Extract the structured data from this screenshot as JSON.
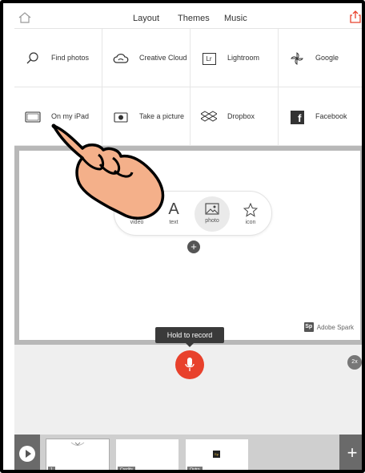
{
  "topbar": {
    "tabs": [
      "Layout",
      "Themes",
      "Music"
    ],
    "home_icon": "home-icon",
    "share_icon": "share-icon",
    "accent": "#e8412c"
  },
  "sources": [
    {
      "label": "Find photos",
      "icon": "search-icon"
    },
    {
      "label": "Creative Cloud",
      "icon": "creative-cloud-icon"
    },
    {
      "label": "Lightroom",
      "icon": "lightroom-icon",
      "icon_text": "Lr"
    },
    {
      "label": "Google",
      "icon": "google-photos-icon"
    },
    {
      "label": "On my iPad",
      "icon": "ipad-icon"
    },
    {
      "label": "Take a picture",
      "icon": "camera-icon"
    },
    {
      "label": "Dropbox",
      "icon": "dropbox-icon"
    },
    {
      "label": "Facebook",
      "icon": "facebook-icon",
      "icon_text": "f"
    }
  ],
  "content_options": [
    {
      "label": "video",
      "icon": "video-icon"
    },
    {
      "label": "text",
      "icon": "text-icon",
      "glyph": "A"
    },
    {
      "label": "photo",
      "icon": "photo-icon",
      "active": true
    },
    {
      "label": "icon",
      "icon": "star-icon"
    }
  ],
  "add_button": "+",
  "brand": {
    "badge": "Sp",
    "name": "Adobe Spark"
  },
  "record": {
    "tooltip": "Hold to record",
    "mic_color": "#e8412c",
    "speed": "2x"
  },
  "filmstrip": {
    "thumbs": [
      {
        "label": "1"
      },
      {
        "label": "Credits"
      },
      {
        "label": "Outro",
        "badge": "Sp"
      }
    ],
    "new_slide": "+"
  }
}
